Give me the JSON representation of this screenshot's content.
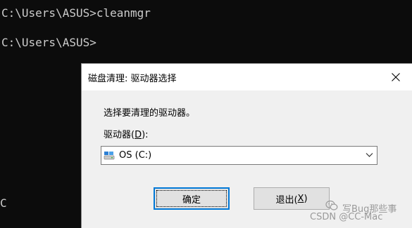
{
  "console": {
    "line1": "C:\\Users\\ASUS>cleanmgr",
    "line2": "C:\\Users\\ASUS>",
    "stub": "C"
  },
  "dialog": {
    "title": "磁盘清理: 驱动器选择",
    "prompt": "选择要清理的驱动器。",
    "drive_label_prefix": "驱动器(",
    "drive_label_accel": "D",
    "drive_label_suffix": "):",
    "drive_selected": "OS (C:)",
    "ok_label": "确定",
    "exit_label_prefix": "退出(",
    "exit_label_accel": "X",
    "exit_label_suffix": ")"
  },
  "watermark": {
    "line1": "写Bug那些事",
    "line2": "CSDN @CC-Mac"
  },
  "icons": {
    "close": "close-icon",
    "drive": "hard-drive-icon",
    "dropdown": "chevron-down-icon",
    "watermark_logo": "wechat-logo-icon"
  },
  "colors": {
    "console_bg": "#0c0c0c",
    "console_text": "#cccccc",
    "dialog_bg": "#f0f0f0",
    "accent": "#0078d7"
  }
}
